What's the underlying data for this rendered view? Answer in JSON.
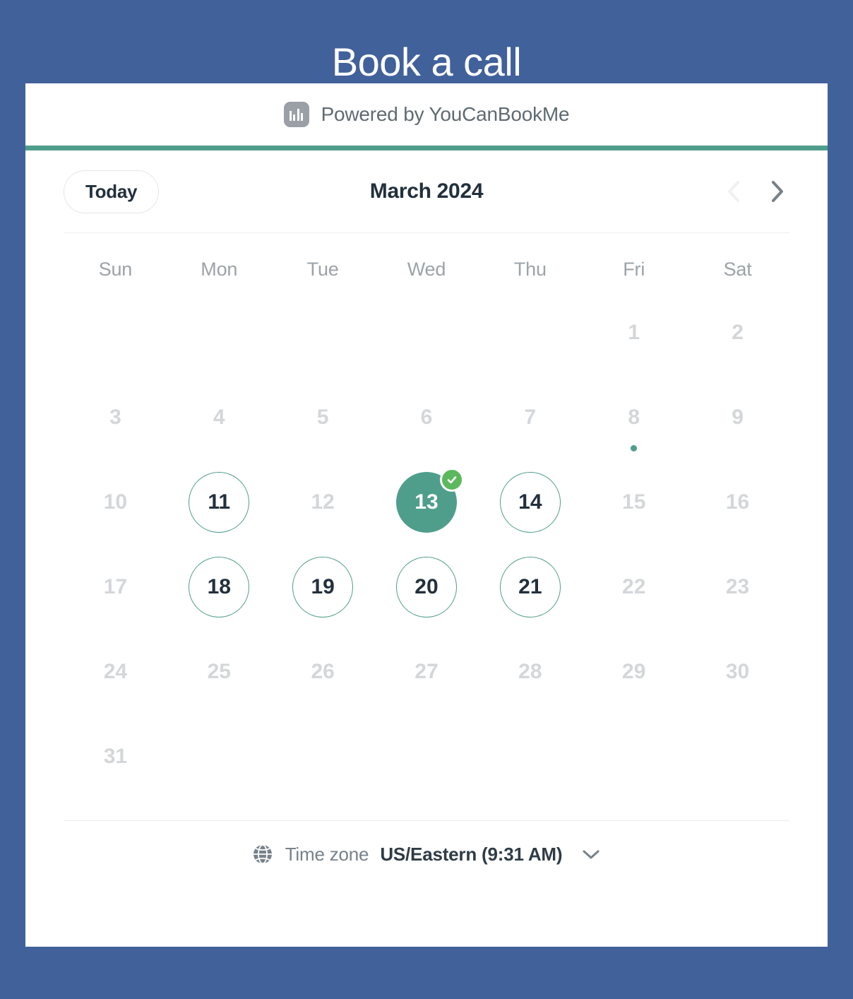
{
  "page": {
    "title": "Book a call",
    "background_color": "#41619b"
  },
  "branding": {
    "logo_icon": "youcanbookme-logo-icon",
    "text": "Powered by YouCanBookMe",
    "accent_color": "#4f9e8c"
  },
  "calendar": {
    "today_label": "Today",
    "month_title": "March 2024",
    "prev_icon": "chevron-left-icon",
    "next_icon": "chevron-right-icon",
    "prev_enabled": false,
    "next_enabled": true,
    "weekdays": [
      "Sun",
      "Mon",
      "Tue",
      "Wed",
      "Thu",
      "Fri",
      "Sat"
    ],
    "selected_day": 13,
    "selected_badge_icon": "check-circle-icon",
    "available_color": "#4f9e8c",
    "selected_color": "#4f9e8c",
    "badge_color": "#5cb85c",
    "disabled_color": "#d4d7d9",
    "cells": [
      {
        "label": "",
        "state": "empty"
      },
      {
        "label": "",
        "state": "empty"
      },
      {
        "label": "",
        "state": "empty"
      },
      {
        "label": "",
        "state": "empty"
      },
      {
        "label": "",
        "state": "empty"
      },
      {
        "label": "1",
        "state": "disabled"
      },
      {
        "label": "2",
        "state": "disabled"
      },
      {
        "label": "3",
        "state": "disabled"
      },
      {
        "label": "4",
        "state": "disabled"
      },
      {
        "label": "5",
        "state": "disabled"
      },
      {
        "label": "6",
        "state": "disabled"
      },
      {
        "label": "7",
        "state": "disabled"
      },
      {
        "label": "8",
        "state": "disabled",
        "dot": true
      },
      {
        "label": "9",
        "state": "disabled"
      },
      {
        "label": "10",
        "state": "disabled"
      },
      {
        "label": "11",
        "state": "available"
      },
      {
        "label": "12",
        "state": "disabled"
      },
      {
        "label": "13",
        "state": "selected",
        "badge": true
      },
      {
        "label": "14",
        "state": "available"
      },
      {
        "label": "15",
        "state": "disabled"
      },
      {
        "label": "16",
        "state": "disabled"
      },
      {
        "label": "17",
        "state": "disabled"
      },
      {
        "label": "18",
        "state": "available"
      },
      {
        "label": "19",
        "state": "available"
      },
      {
        "label": "20",
        "state": "available"
      },
      {
        "label": "21",
        "state": "available"
      },
      {
        "label": "22",
        "state": "disabled"
      },
      {
        "label": "23",
        "state": "disabled"
      },
      {
        "label": "24",
        "state": "disabled"
      },
      {
        "label": "25",
        "state": "disabled"
      },
      {
        "label": "26",
        "state": "disabled"
      },
      {
        "label": "27",
        "state": "disabled"
      },
      {
        "label": "28",
        "state": "disabled"
      },
      {
        "label": "29",
        "state": "disabled"
      },
      {
        "label": "30",
        "state": "disabled"
      },
      {
        "label": "31",
        "state": "disabled"
      },
      {
        "label": "",
        "state": "empty"
      },
      {
        "label": "",
        "state": "empty"
      },
      {
        "label": "",
        "state": "empty"
      },
      {
        "label": "",
        "state": "empty"
      },
      {
        "label": "",
        "state": "empty"
      },
      {
        "label": "",
        "state": "empty"
      }
    ]
  },
  "timezone": {
    "globe_icon": "globe-icon",
    "label": "Time zone",
    "value": "US/Eastern (9:31 AM)",
    "caret_icon": "chevron-down-icon"
  }
}
